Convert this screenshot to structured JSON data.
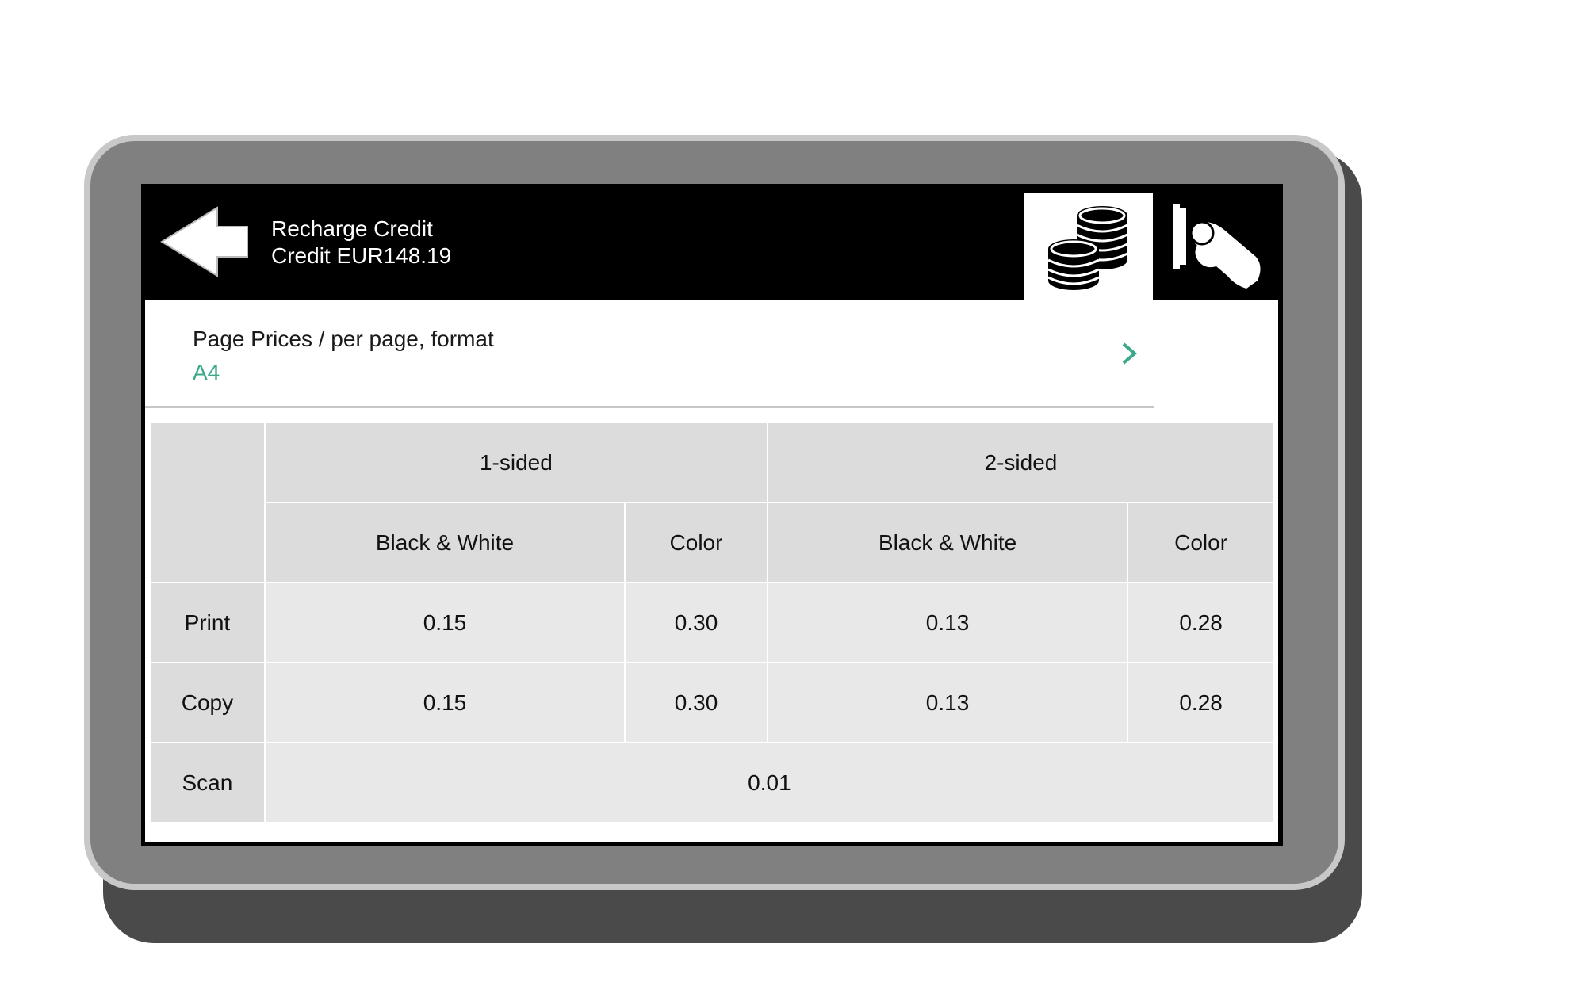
{
  "header": {
    "title": "Recharge Credit",
    "credit": "Credit EUR148.19",
    "back_icon": "back-arrow-icon",
    "tabs": [
      {
        "icon": "coins-icon",
        "selected": true
      },
      {
        "icon": "insert-card-icon",
        "selected": false
      }
    ]
  },
  "format": {
    "label": "Page Prices / per page, format",
    "value": "A4",
    "accent_color": "#3aa88a"
  },
  "table": {
    "group_headers": [
      "1-sided",
      "2-sided"
    ],
    "sub_headers": [
      "Black & White",
      "Color",
      "Black & White",
      "Color"
    ],
    "rows": [
      {
        "label": "Print",
        "values": [
          "0.15",
          "0.30",
          "0.13",
          "0.28"
        ]
      },
      {
        "label": "Copy",
        "values": [
          "0.15",
          "0.30",
          "0.13",
          "0.28"
        ]
      }
    ],
    "scan": {
      "label": "Scan",
      "value": "0.01"
    }
  }
}
